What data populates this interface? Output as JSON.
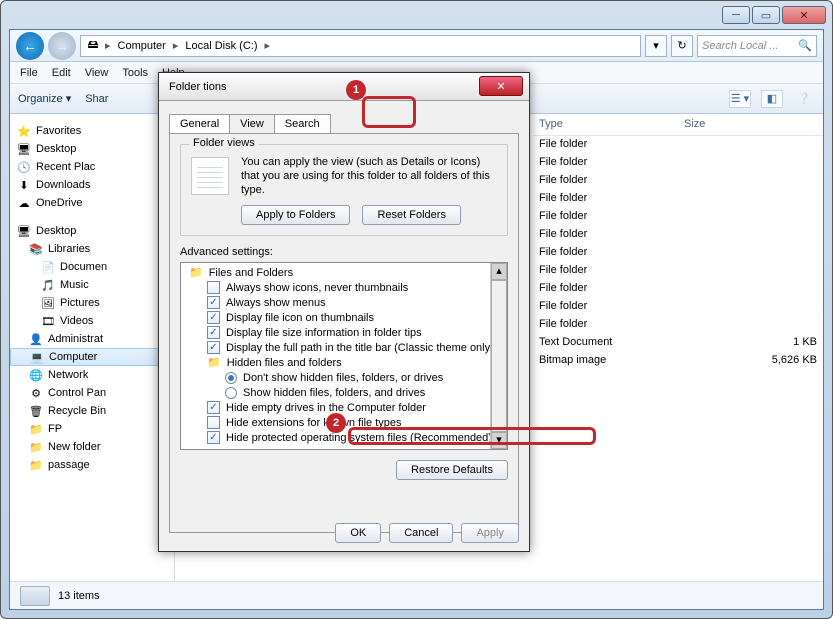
{
  "window": {
    "breadcrumbs": [
      "Computer",
      "Local Disk (C:)"
    ],
    "search_placeholder": "Search Local ...",
    "menu": [
      "File",
      "Edit",
      "View",
      "Tools",
      "Help"
    ],
    "toolbar": {
      "organize": "Organize",
      "share": "Shar"
    },
    "status": "13 items"
  },
  "tree": {
    "favorites_hdr": "Favorites",
    "favorites": [
      "Desktop",
      "Recent Plac",
      "Downloads",
      "OneDrive"
    ],
    "desktop_hdr": "Desktop",
    "libraries_hdr": "Libraries",
    "libraries": [
      "Documen",
      "Music",
      "Pictures",
      "Videos"
    ],
    "items": [
      "Administrat",
      "Computer",
      "Network",
      "Control Pan",
      "Recycle Bin",
      "FP",
      "New folder",
      "passage"
    ]
  },
  "list": {
    "cols": [
      "Type",
      "Size"
    ],
    "rows": [
      {
        "type": "File folder",
        "size": ""
      },
      {
        "type": "File folder",
        "size": ""
      },
      {
        "type": "File folder",
        "size": ""
      },
      {
        "type": "File folder",
        "size": ""
      },
      {
        "type": "File folder",
        "size": ""
      },
      {
        "type": "File folder",
        "size": ""
      },
      {
        "type": "File folder",
        "size": ""
      },
      {
        "type": "File folder",
        "size": ""
      },
      {
        "type": "File folder",
        "size": ""
      },
      {
        "type": "File folder",
        "size": ""
      },
      {
        "type": "File folder",
        "size": ""
      },
      {
        "type": "Text Document",
        "size": "1 KB"
      },
      {
        "type": "Bitmap image",
        "size": "5,626 KB"
      }
    ]
  },
  "dialog": {
    "title": "Folder      tions",
    "tabs": [
      "General",
      "View",
      "Search"
    ],
    "folder_views_title": "Folder views",
    "folder_views_desc": "You can apply the view (such as Details or Icons) that you are using for this folder to all folders of this type.",
    "apply_btn": "Apply to Folders",
    "reset_btn": "Reset Folders",
    "adv_label": "Advanced settings:",
    "adv_hdr": "Files and Folders",
    "adv_sub_hdr": "Hidden files and folders",
    "adv_items": [
      {
        "kind": "check",
        "checked": false,
        "label": "Always show icons, never thumbnails"
      },
      {
        "kind": "check",
        "checked": true,
        "label": "Always show menus"
      },
      {
        "kind": "check",
        "checked": true,
        "label": "Display file icon on thumbnails"
      },
      {
        "kind": "check",
        "checked": true,
        "label": "Display file size information in folder tips"
      },
      {
        "kind": "check",
        "checked": true,
        "label": "Display the full path in the title bar (Classic theme only)"
      },
      {
        "kind": "radio",
        "checked": true,
        "label": "Don't show hidden files, folders, or drives"
      },
      {
        "kind": "radio",
        "checked": false,
        "label": "Show hidden files, folders, and drives"
      },
      {
        "kind": "check",
        "checked": true,
        "label": "Hide empty drives in the Computer folder"
      },
      {
        "kind": "check",
        "checked": false,
        "label": "Hide extensions for known file types"
      },
      {
        "kind": "check",
        "checked": true,
        "label": "Hide protected operating system files (Recommended)"
      }
    ],
    "restore": "Restore Defaults",
    "ok": "OK",
    "cancel": "Cancel",
    "apply": "Apply"
  },
  "callouts": {
    "one": "1",
    "two": "2"
  }
}
